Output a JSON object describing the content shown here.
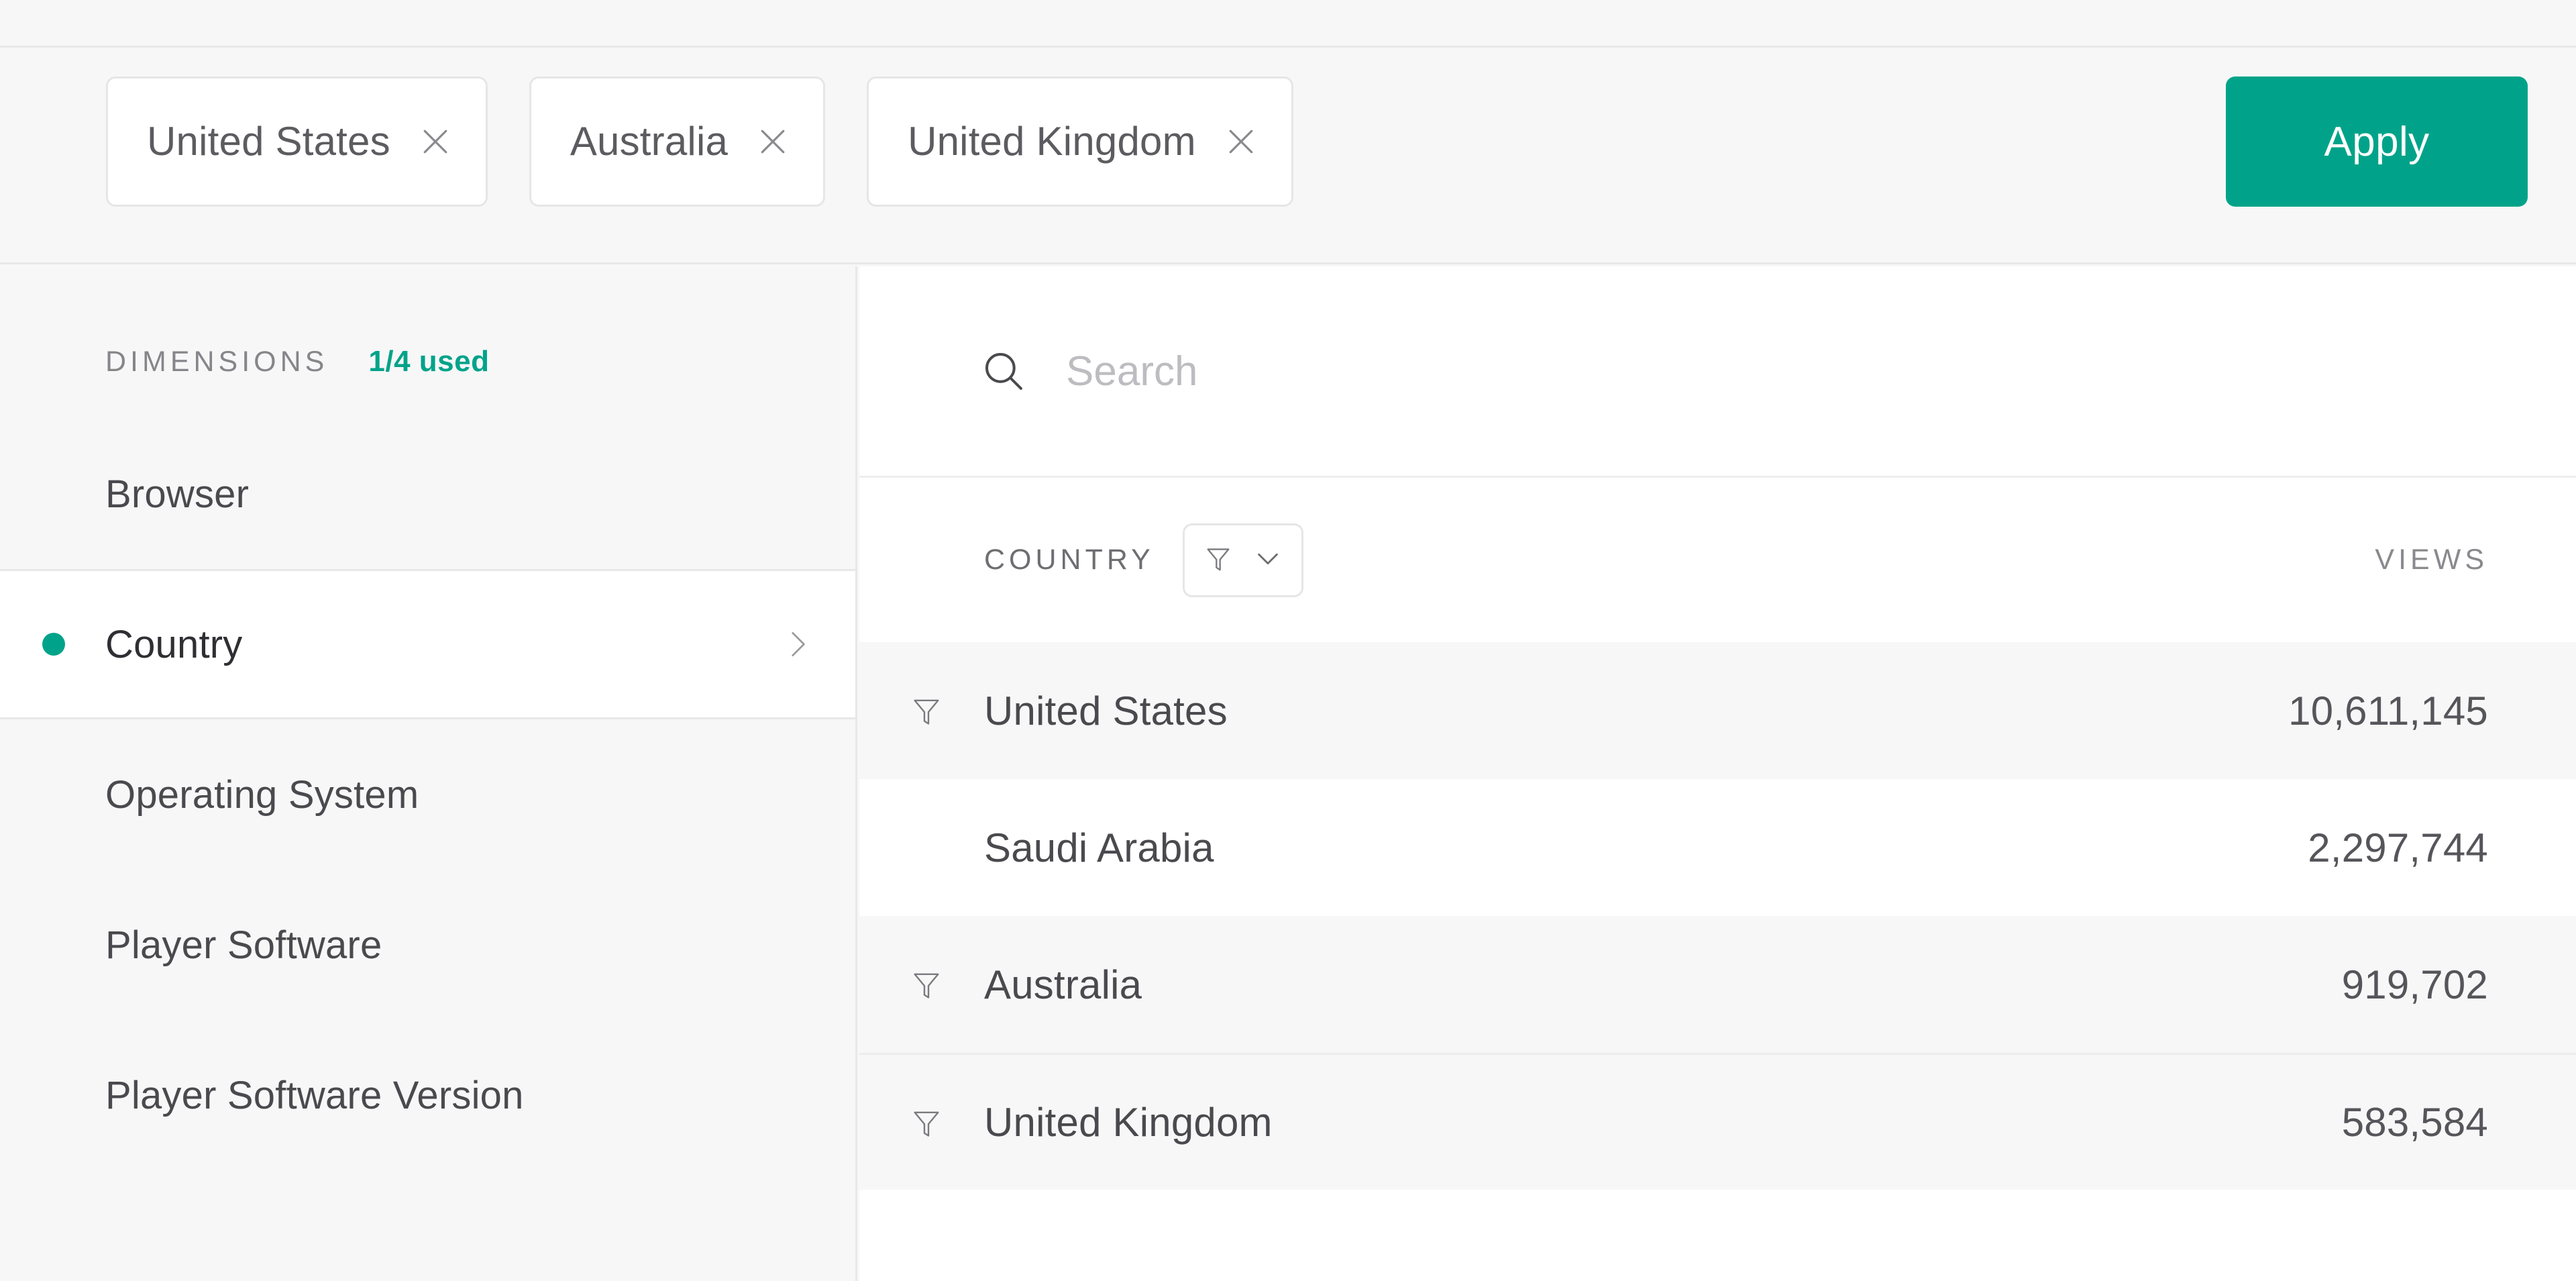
{
  "theme": {
    "accent": "#00a389",
    "page_bg": "#f7f7f8",
    "panel_bg": "#ffffff",
    "border": "#e8e8ea",
    "text_primary": "#3a3a3e",
    "text_muted": "#86868a"
  },
  "filter_bar": {
    "chips": [
      {
        "label": "United States",
        "remove_icon": "close-icon"
      },
      {
        "label": "Australia",
        "remove_icon": "close-icon"
      },
      {
        "label": "United Kingdom",
        "remove_icon": "close-icon"
      }
    ],
    "apply_label": "Apply"
  },
  "sidebar": {
    "header": {
      "title": "DIMENSIONS",
      "usage": "1/4 used"
    },
    "items": [
      {
        "label": "Browser",
        "selected": false
      },
      {
        "label": "Country",
        "selected": true,
        "dot_icon": "status-dot-icon",
        "chevron_icon": "chevron-right-icon"
      },
      {
        "label": "Operating System",
        "selected": false
      },
      {
        "label": "Player Software",
        "selected": false
      },
      {
        "label": "Player Software Version",
        "selected": false
      }
    ]
  },
  "panel": {
    "search": {
      "icon": "search-icon",
      "value": "",
      "placeholder": "Search"
    },
    "table": {
      "columns": {
        "name": "COUNTRY",
        "value": "VIEWS"
      },
      "filter_control": {
        "filter_icon": "funnel-icon",
        "chevron_icon": "chevron-down-icon"
      },
      "rows": [
        {
          "name": "United States",
          "value": "10,611,145",
          "filtered": true,
          "shaded": true,
          "divider": false
        },
        {
          "name": "Saudi Arabia",
          "value": "2,297,744",
          "filtered": false,
          "shaded": false,
          "divider": false
        },
        {
          "name": "Australia",
          "value": "919,702",
          "filtered": true,
          "shaded": true,
          "divider": false
        },
        {
          "name": "United Kingdom",
          "value": "583,584",
          "filtered": true,
          "shaded": true,
          "divider": true
        }
      ]
    }
  }
}
